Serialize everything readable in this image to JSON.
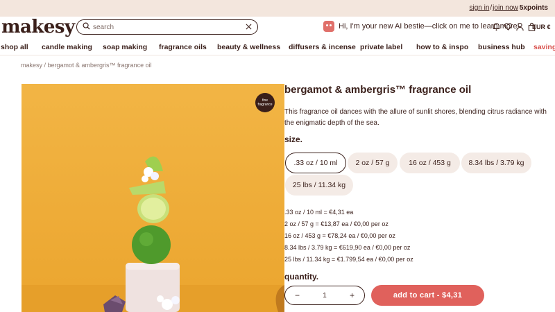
{
  "topbar": {
    "sign_in": "sign in",
    "join_now": "join now",
    "points": "5xpoints"
  },
  "header": {
    "logo": "makesy",
    "search_placeholder": "search",
    "bestie_text": "Hi, I'm your new AI bestie—click on me to learn more!",
    "currency": "EUR €",
    "icons": [
      "bell-icon",
      "heart-icon",
      "user-icon",
      "cart-icon"
    ]
  },
  "nav": {
    "items": [
      "shop all",
      "candle making",
      "soap making",
      "fragrance oils",
      "beauty & wellness",
      "diffusers & incense",
      "private label",
      "how to & inspo",
      "business hub",
      "savings"
    ]
  },
  "breadcrumb": "makesy / bergamot & ambergris™ fragrance oil",
  "product": {
    "badge": "fine fragrance",
    "title": "bergamot & ambergris™ fragrance oil",
    "description": "This fragrance oil dances with the allure of sunlit shores, blending citrus radiance with the enigmatic depth of the sea.",
    "size_label": "size.",
    "sizes": [
      ".33 oz / 10 ml",
      "2 oz / 57 g",
      "16 oz / 453 g",
      "8.34 lbs / 3.79 kg",
      "25 lbs / 11.34 kg"
    ],
    "selected_size": ".33 oz / 10 ml",
    "prices": [
      ".33 oz / 10 ml = €4,31 ea",
      "2 oz / 57 g = €13,87 ea / €0,00 per oz",
      "16 oz / 453 g = €78,24 ea / €0,00 per oz",
      "8.34 lbs / 3.79 kg = €619,90 ea / €0,00 per oz",
      "25 lbs / 11.34 kg = €1.799,54 ea / €0,00 per oz"
    ],
    "quantity_label": "quantity.",
    "quantity": "1",
    "minus": "−",
    "plus": "+",
    "add_to_cart": "add to cart  -  $4,31"
  },
  "colors": {
    "accent": "#e0615c",
    "text": "#3a1f1a",
    "image_bg": "#f2b13a",
    "chip": "#f4ebe6"
  }
}
